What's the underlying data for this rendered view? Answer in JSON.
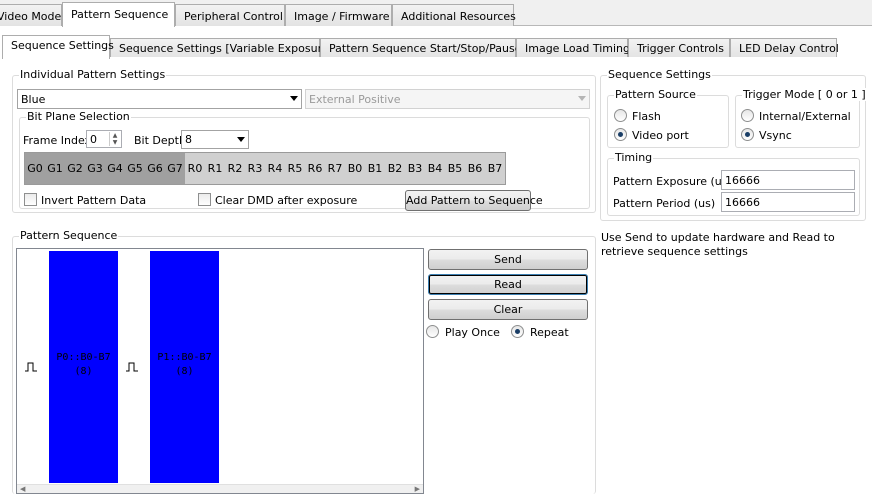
{
  "main_tabs": [
    "Video Mode",
    "Pattern Sequence",
    "Peripheral Control",
    "Image / Firmware",
    "Additional Resources"
  ],
  "sub_tabs": [
    "Sequence Settings",
    "Sequence Settings [Variable Exposure]",
    "Pattern Sequence Start/Stop/Pause",
    "Image Load Timing",
    "Trigger Controls",
    "LED Delay Control"
  ],
  "individual": {
    "title": "Individual Pattern Settings",
    "color_value": "Blue",
    "trigger_value": "External Positive",
    "bitplane_title": "Bit Plane Selection",
    "frame_index_label": "Frame Index",
    "frame_index_value": "0",
    "bit_depth_label": "Bit Depth",
    "bit_depth_value": "8",
    "bits": [
      "G0",
      "G1",
      "G2",
      "G3",
      "G4",
      "G5",
      "G6",
      "G7",
      "R0",
      "R1",
      "R2",
      "R3",
      "R4",
      "R5",
      "R6",
      "R7",
      "B0",
      "B1",
      "B2",
      "B3",
      "B4",
      "B5",
      "B6",
      "B7"
    ],
    "invert_label": "Invert Pattern Data",
    "clear_dmd_label": "Clear DMD after exposure",
    "add_button": "Add Pattern to Sequence"
  },
  "pattern_sequence": {
    "title": "Pattern Sequence",
    "items": [
      {
        "label": "P0::B0-B7",
        "sub": "(8)"
      },
      {
        "label": "P1::B0-B7",
        "sub": "(8)"
      }
    ],
    "send": "Send",
    "read": "Read",
    "clear": "Clear",
    "play_once": "Play Once",
    "repeat": "Repeat"
  },
  "sequence_settings": {
    "title": "Sequence Settings",
    "source_title": "Pattern Source",
    "flash": "Flash",
    "video_port": "Video port",
    "trigger_title": "Trigger Mode [ 0 or 1 ]",
    "internal": "Internal/External",
    "vsync": "Vsync",
    "timing_title": "Timing",
    "exposure_label": "Pattern Exposure (us)",
    "exposure_value": "16666",
    "period_label": "Pattern Period (us)",
    "period_value": "16666"
  },
  "help_text": "Use Send to update hardware and Read to retrieve sequence settings",
  "colors": {
    "pattern_block": "#0000ff"
  }
}
